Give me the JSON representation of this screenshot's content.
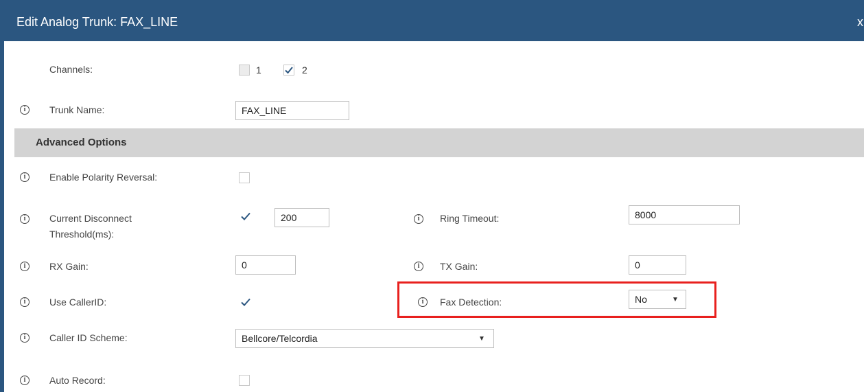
{
  "dialog": {
    "title": "Edit Analog Trunk: FAX_LINE",
    "close_label": "x"
  },
  "channels": {
    "label": "Channels:",
    "options": [
      {
        "label": "1",
        "checked": false
      },
      {
        "label": "2",
        "checked": true
      }
    ]
  },
  "trunk_name": {
    "label": "Trunk Name:",
    "value": "FAX_LINE"
  },
  "advanced": {
    "section_title": "Advanced Options",
    "polarity_reversal": {
      "label": "Enable Polarity Reversal:",
      "checked": false
    },
    "current_disconnect": {
      "label_line1": "Current Disconnect",
      "label_line2": "Threshold(ms):",
      "checked": true,
      "value": "200"
    },
    "ring_timeout": {
      "label": "Ring Timeout:",
      "value": "8000"
    },
    "rx_gain": {
      "label": "RX Gain:",
      "value": "0"
    },
    "tx_gain": {
      "label": "TX Gain:",
      "value": "0"
    },
    "use_callerid": {
      "label": "Use CallerID:",
      "checked": true
    },
    "fax_detection": {
      "label": "Fax Detection:",
      "value": "No"
    },
    "caller_id_scheme": {
      "label": "Caller ID Scheme:",
      "value": "Bellcore/Telcordia"
    },
    "auto_record": {
      "label": "Auto Record:",
      "checked": false
    }
  },
  "icons": {
    "info": "info-icon",
    "check": "check-icon",
    "dropdown": "dropdown-arrow-icon"
  },
  "colors": {
    "header": "#2b5680",
    "section": "#d3d3d3",
    "highlight": "#e8201e",
    "check": "#2b5680"
  }
}
